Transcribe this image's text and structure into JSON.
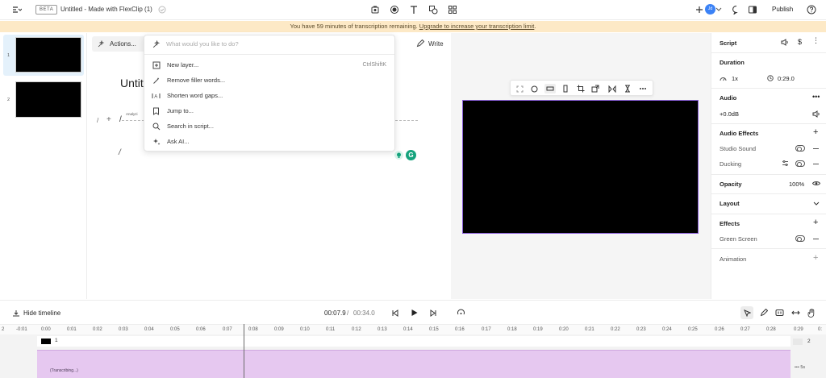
{
  "topbar": {
    "beta": "BETA",
    "title": "Untitled - Made with FlexClip (1)",
    "avatar_initials": "Jd",
    "publish": "Publish"
  },
  "banner": {
    "text": "You have 59 minutes of transcription remaining.",
    "link": "Upgrade to increase your transcription limit",
    "end": "."
  },
  "thumbs": [
    {
      "num": "1",
      "selected": true
    },
    {
      "num": "2",
      "selected": false
    }
  ],
  "script": {
    "actions_label": "Actions...",
    "write_label": "Write",
    "heading": "Untitl",
    "analyzing": "Analyzi",
    "slash_char": "/"
  },
  "dropdown": {
    "placeholder": "What would you like to do?",
    "items": [
      {
        "label": "New layer...",
        "shortcut": "CtrlShiftK",
        "icon": "square-plus-icon"
      },
      {
        "label": "Remove filler words...",
        "shortcut": "",
        "icon": "wand-icon"
      },
      {
        "label": "Shorten word gaps...",
        "shortcut": "",
        "icon": "text-cursor-icon"
      },
      {
        "label": "Jump to...",
        "shortcut": "",
        "icon": "bookmark-icon"
      },
      {
        "label": "Search in script...",
        "shortcut": "",
        "icon": "search-icon"
      },
      {
        "label": "Ask AI...",
        "shortcut": "",
        "icon": "sparkle-icon"
      }
    ]
  },
  "rpanel": {
    "script": "Script",
    "duration": "Duration",
    "speed": "1x",
    "duration_value": "0:29.0",
    "audio": "Audio",
    "volume": "+0.0dB",
    "audio_effects": "Audio Effects",
    "studio_sound": "Studio Sound",
    "ducking": "Ducking",
    "opacity": "Opacity",
    "opacity_value": "100%",
    "layout": "Layout",
    "effects": "Effects",
    "green_screen": "Green Screen",
    "animation": "Animation"
  },
  "timeline": {
    "hide_label": "Hide timeline",
    "current_time": "00:07.9",
    "sep": "/",
    "total_time": "00:34.0",
    "ruler": [
      "2",
      "-0:01",
      "0:00",
      "0:01",
      "0:02",
      "0:03",
      "0:04",
      "0:05",
      "0:06",
      "0:07",
      "0:08",
      "0:09",
      "0:10",
      "0:11",
      "0:12",
      "0:13",
      "0:14",
      "0:15",
      "0:16",
      "0:17",
      "0:18",
      "0:19",
      "0:20",
      "0:21",
      "0:22",
      "0:23",
      "0:24",
      "0:25",
      "0:26",
      "0:27",
      "0:28",
      "0:29",
      "0:"
    ],
    "clip_num": "1",
    "row_right_num": "2",
    "audio_label": "(Transcribing...)",
    "zoom": "5s"
  },
  "colors": {
    "banner_bg": "#fde9c6",
    "selection": "#e4f1fb",
    "canvas_border": "#8a5fd9",
    "audio_clip": "#e6c8f0",
    "grammarly": "#15a37d"
  }
}
